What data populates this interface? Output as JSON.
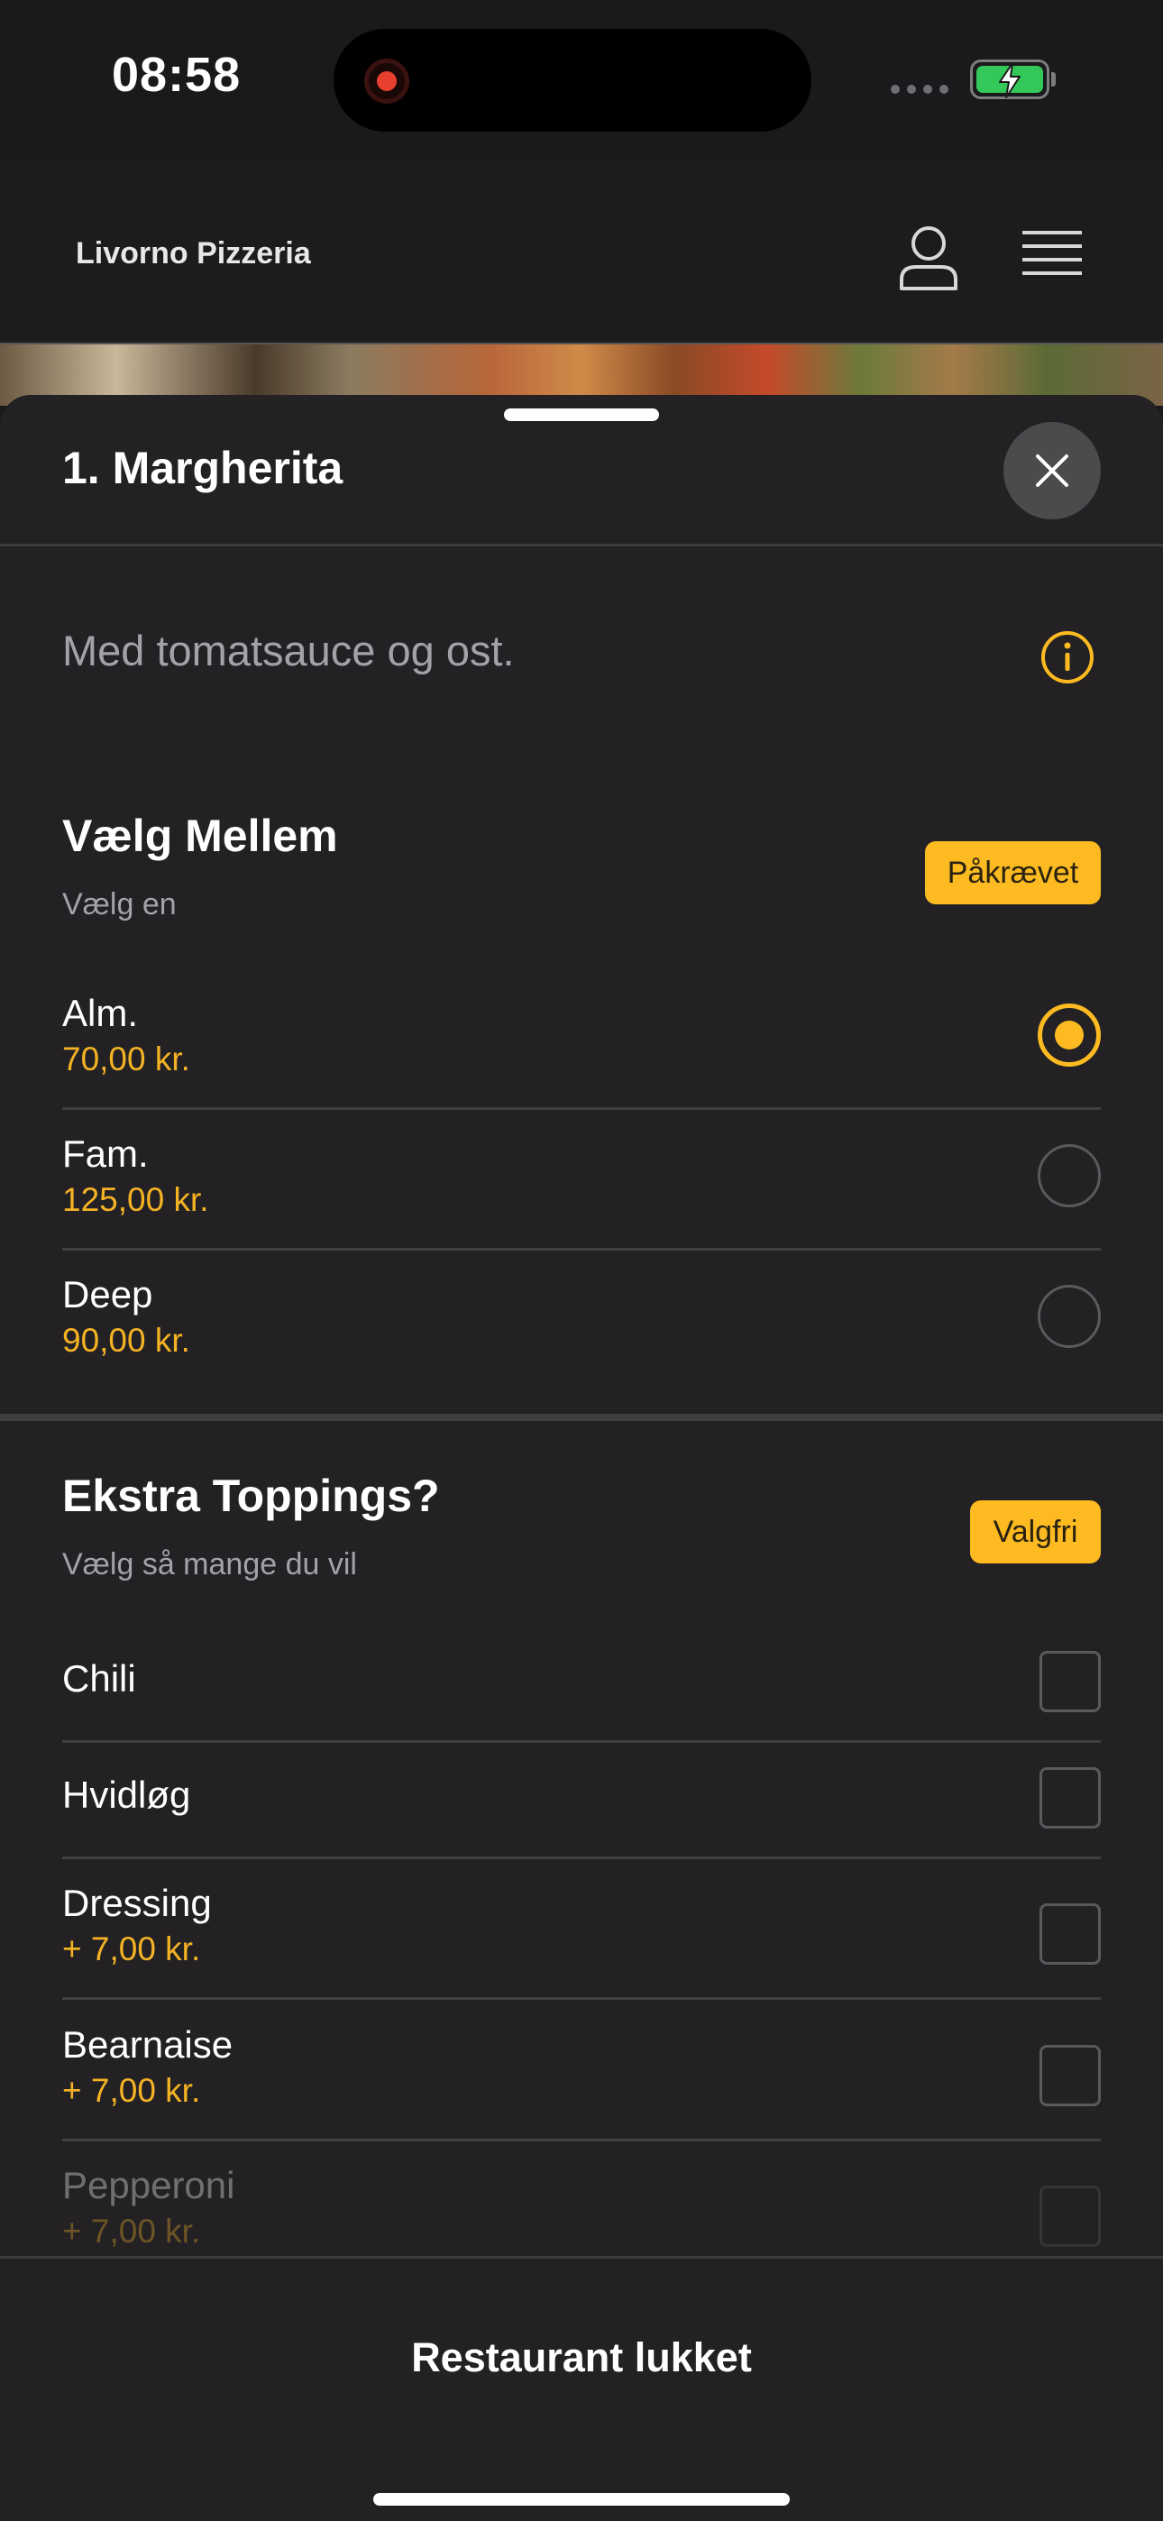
{
  "status_bar": {
    "time": "08:58"
  },
  "header": {
    "title": "Livorno Pizzeria",
    "icons": [
      "user-icon",
      "menu-icon"
    ]
  },
  "sheet": {
    "title": "1. Margherita",
    "description": "Med tomatsauce og ost.",
    "groups": [
      {
        "title": "Vælg Mellem",
        "subtitle": "Vælg en",
        "badge": "Påkrævet",
        "type": "radio",
        "options": [
          {
            "label": "Alm.",
            "price": "70,00 kr.",
            "selected": true
          },
          {
            "label": "Fam.",
            "price": "125,00 kr.",
            "selected": false
          },
          {
            "label": "Deep",
            "price": "90,00 kr.",
            "selected": false
          }
        ]
      },
      {
        "title": "Ekstra Toppings?",
        "subtitle": "Vælg så mange du vil",
        "badge": "Valgfri",
        "type": "checkbox",
        "options": [
          {
            "label": "Chili",
            "price": "",
            "checked": false
          },
          {
            "label": "Hvidløg",
            "price": "",
            "checked": false
          },
          {
            "label": "Dressing",
            "price": "+ 7,00 kr.",
            "checked": false
          },
          {
            "label": "Bearnaise",
            "price": "+ 7,00 kr.",
            "checked": false
          },
          {
            "label": "Pepperoni",
            "price": "+ 7,00 kr.",
            "checked": false
          }
        ]
      }
    ]
  },
  "footer": {
    "label": "Restaurant lukket"
  },
  "colors": {
    "accent": "#fdbb21",
    "price": "#f5b324",
    "background": "#232124",
    "battery": "#34c759",
    "record": "#e8402f"
  }
}
